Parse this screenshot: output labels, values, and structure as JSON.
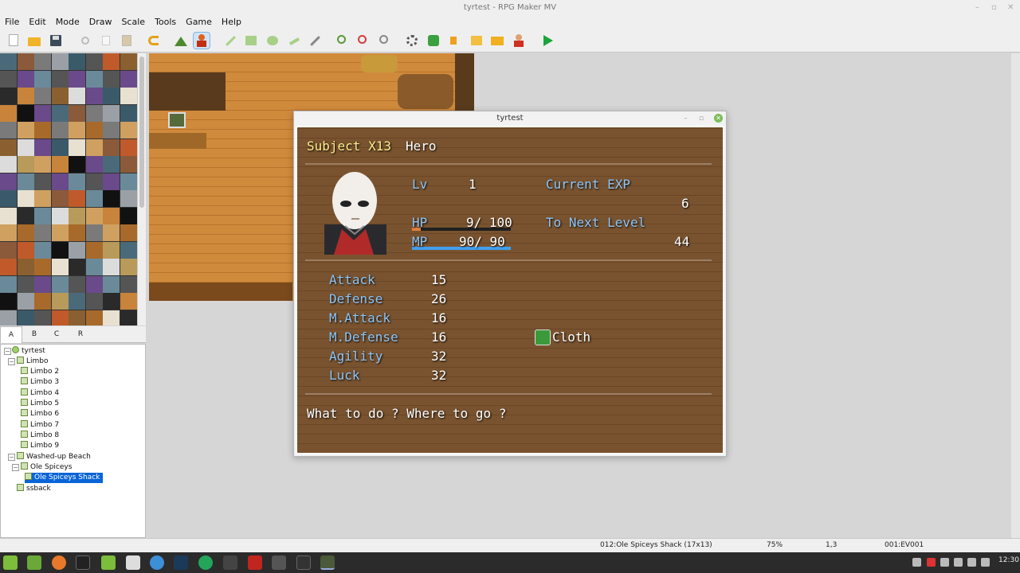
{
  "window": {
    "title": "tyrtest - RPG Maker MV"
  },
  "menu": [
    "File",
    "Edit",
    "Mode",
    "Draw",
    "Scale",
    "Tools",
    "Game",
    "Help"
  ],
  "toolbar": {
    "icons": [
      "new-project-icon",
      "open-project-icon",
      "save-project-icon",
      "cut-icon",
      "copy-icon",
      "paste-icon",
      "undo-icon",
      "map-mode-icon",
      "event-mode-icon",
      "pencil-icon",
      "rectangle-icon",
      "ellipse-icon",
      "fill-icon",
      "shadow-pen-icon",
      "zoom-in-icon",
      "zoom-out-icon",
      "actual-size-icon",
      "database-icon",
      "plugin-manager-icon",
      "sound-test-icon",
      "event-searcher-icon",
      "resource-manager-icon",
      "character-generator-icon",
      "playtest-icon"
    ]
  },
  "tileset_tabs": [
    "A",
    "B",
    "C",
    "R"
  ],
  "map_tree": {
    "root": "tyrtest",
    "items": [
      "Limbo",
      "Limbo 2",
      "Limbo 3",
      "Limbo 4",
      "Limbo 5",
      "Limbo 6",
      "Limbo 7",
      "Limbo 8",
      "Limbo 9",
      "Washed-up Beach",
      "Ole Spiceys",
      "Ole Spiceys Shack",
      "ssback"
    ],
    "selected": "Ole Spiceys Shack"
  },
  "playtest": {
    "title": "tyrtest",
    "actor_name": "Subject X13",
    "actor_class": "Hero",
    "level_label": "Lv",
    "level_value": "1",
    "exp_label": "Current EXP",
    "exp_value": "6",
    "next_label": "To Next Level",
    "next_value": "44",
    "hp_label": "HP",
    "hp_value": "9/ 100",
    "hp_ratio": 0.09,
    "mp_label": "MP",
    "mp_value": "90/ 90",
    "mp_ratio": 1.0,
    "params": [
      {
        "name": "Attack",
        "value": "15"
      },
      {
        "name": "Defense",
        "value": "26"
      },
      {
        "name": "M.Attack",
        "value": "16"
      },
      {
        "name": "M.Defense",
        "value": "16"
      },
      {
        "name": "Agility",
        "value": "32"
      },
      {
        "name": "Luck",
        "value": "32"
      }
    ],
    "equip": "Cloth",
    "profile": "What to do ? Where to go ?"
  },
  "statusbar": {
    "map": "012:Ole Spiceys Shack (17x13)",
    "zoom": "75%",
    "coords": "1,3",
    "event": "001:EV001"
  },
  "taskbar": {
    "clock": "12:30"
  },
  "colors": {
    "system_text": "#8ec6f7",
    "name_text": "#ffee8c",
    "hp_gauge": "#e08040",
    "mp_gauge": "#40a0f0",
    "selection": "#0a64d8"
  }
}
